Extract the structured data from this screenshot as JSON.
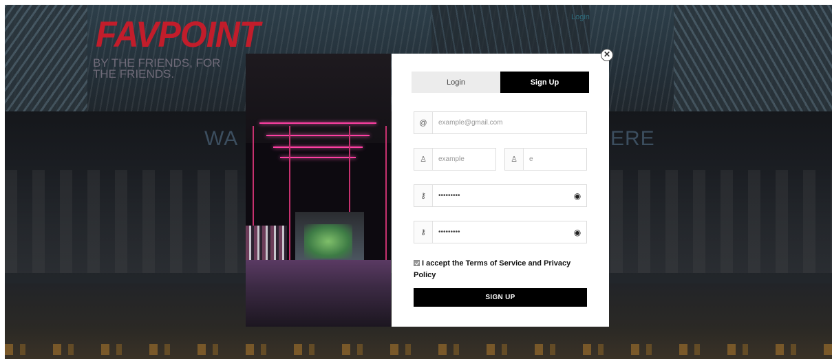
{
  "background": {
    "brand": "FAVPOINT",
    "tagline": "BY THE FRIENDS, FOR THE FRIENDS.",
    "top_login": "Login",
    "hero_left": "WA",
    "hero_right": "ERE"
  },
  "modal": {
    "close_glyph": "✕",
    "tabs": [
      {
        "label": "Login",
        "active": false
      },
      {
        "label": "Sign Up",
        "active": true
      }
    ],
    "email": {
      "icon": "at-icon",
      "icon_glyph": "@",
      "placeholder": "example@gmail.com",
      "value": ""
    },
    "first_name": {
      "icon": "user-icon",
      "icon_glyph": "♙",
      "placeholder": "example",
      "value": ""
    },
    "last_name": {
      "icon": "user-icon",
      "icon_glyph": "♙",
      "placeholder": "e",
      "value": ""
    },
    "password": {
      "icon": "key-icon",
      "icon_glyph": "⚷",
      "value": "•••••••••",
      "eye_glyph": "◉"
    },
    "confirm_password": {
      "icon": "key-icon",
      "icon_glyph": "⚷",
      "value": "•••••••••",
      "eye_glyph": "◉"
    },
    "terms": {
      "checked": true,
      "label": "I accept the Terms of Service and Privacy Policy"
    },
    "submit_label": "SIGN UP"
  },
  "colors": {
    "brand_red": "#c21d2b",
    "button_black": "#000000",
    "neon_pink": "#ff3fa3"
  }
}
